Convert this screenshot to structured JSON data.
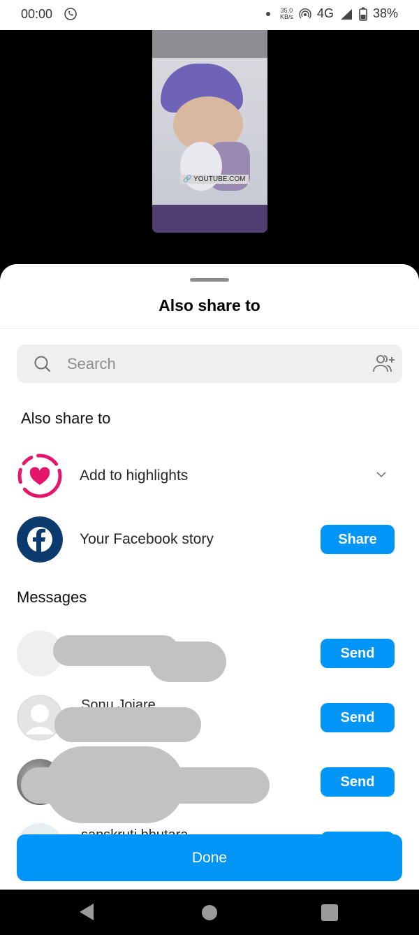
{
  "status_bar": {
    "time": "00:00",
    "speed_value": "35.0",
    "speed_unit": "KB/s",
    "network": "4G",
    "battery": "38%"
  },
  "story_preview": {
    "link_label": "YOUTUBE.COM"
  },
  "sheet": {
    "title": "Also share to",
    "search": {
      "placeholder": "Search"
    },
    "also_share_section": "Also share to",
    "options": [
      {
        "label": "Add to highlights",
        "icon": "highlight-heart-icon"
      },
      {
        "label": "Your Facebook story",
        "icon": "facebook-icon",
        "button": "Share"
      }
    ],
    "messages_section": "Messages",
    "contacts": [
      {
        "name": "",
        "partial_visible": "",
        "button": "Send"
      },
      {
        "name": "Sonu Joiare",
        "button": "Send"
      },
      {
        "name": "",
        "button": "Send"
      },
      {
        "name": "sanskruti bhutara",
        "button": "Send"
      }
    ],
    "done_label": "Done"
  },
  "colors": {
    "accent": "#0095f6",
    "highlight_pink": "#e4166b",
    "facebook_navy": "#0b3a6e"
  }
}
